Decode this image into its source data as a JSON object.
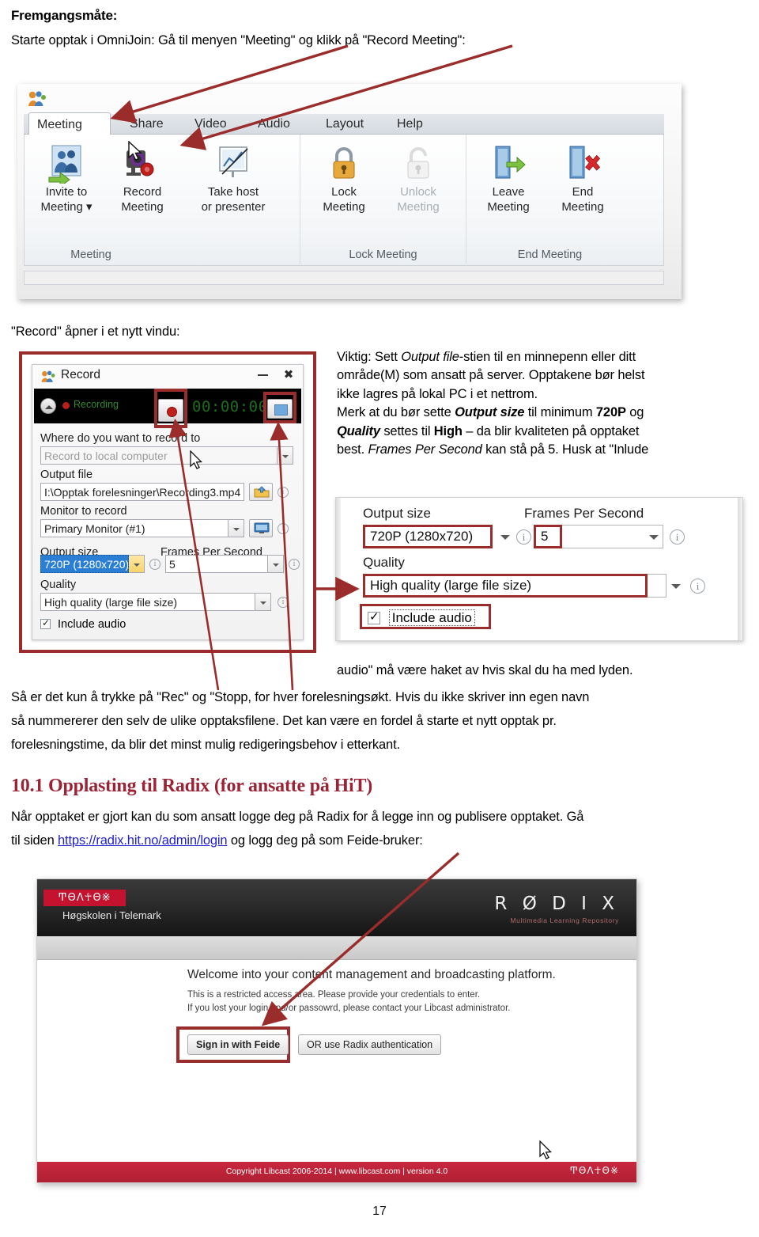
{
  "document": {
    "heading": "Fremgangsmåte:",
    "intro": "Starte opptak i OmniJoin: Gå til menyen \"Meeting\" og klikk på \"Record Meeting\":",
    "record_caption": "\"Record\" åpner i et nytt vindu:",
    "note_line1_pre": "Viktig: Sett ",
    "note_line1_em": "Output file",
    "note_line1_post": "-stien til en minnepenn eller ditt",
    "note_line2": "område(M) som ansatt på server. Opptakene bør helst",
    "note_line3": "ikke lagres på lokal PC i et nettrom.",
    "note_line4_pre": "Merk at du bør sette ",
    "note_line4_em": "Output size",
    "note_line4_mid": " til minimum ",
    "note_line4_b": "720P",
    "note_line4_post": " og",
    "note_line5_em": "Quality",
    "note_line5_mid": " settes til ",
    "note_line5_b": "High",
    "note_line5_post": " – da blir kvaliteten på opptaket",
    "note_line6_pre": "best. ",
    "note_line6_em": "Frames Per Second",
    "note_line6_post": " kan stå på 5. Husk at \"Inlude",
    "para_cont": "audio\" må være haket av hvis skal du ha med lyden.",
    "para2_line1": "Så er det kun å trykke på \"Rec\" og \"Stopp, for hver forelesningsøkt. Hvis du ikke skriver inn egen navn",
    "para2_line2": "så nummererer den selv de ulike opptaksfilene.  Det kan være en fordel å starte et nytt opptak pr.",
    "para2_line3": "forelesningstime, da blir det minst mulig redigeringsbehov i etterkant.",
    "section_heading": "10.1 Opplasting til Radix (for ansatte på HiT)",
    "para3_line1": "Når opptaket er gjort kan du som ansatt logge deg på Radix for å legge inn og publisere opptaket. Gå",
    "para3_line2_pre": "til siden ",
    "para3_link": "https://radix.hit.no/admin/login",
    "para3_line2_post": " og logg deg på som Feide-bruker:",
    "page_number": "17"
  },
  "omnijoin": {
    "tabs": [
      {
        "label": "Meeting",
        "active": true
      },
      {
        "label": "Share",
        "active": false
      },
      {
        "label": "Video",
        "active": false
      },
      {
        "label": "Audio",
        "active": false
      },
      {
        "label": "Layout",
        "active": false
      },
      {
        "label": "Help",
        "active": false
      }
    ],
    "groups": [
      {
        "name": "Meeting"
      },
      {
        "name": "Lock Meeting"
      },
      {
        "name": "End Meeting"
      }
    ],
    "buttons": [
      {
        "line1": "Invite to",
        "line2": "Meeting ▾",
        "icon": "invite-people-icon",
        "disabled": false
      },
      {
        "line1": "Record",
        "line2": "Meeting",
        "icon": "record-camera-icon",
        "disabled": false
      },
      {
        "line1": "Take host",
        "line2": "or presenter",
        "icon": "presenter-board-icon",
        "disabled": false
      },
      {
        "line1": "Lock",
        "line2": "Meeting",
        "icon": "padlock-closed-icon",
        "disabled": false
      },
      {
        "line1": "Unlock",
        "line2": "Meeting",
        "icon": "padlock-open-icon",
        "disabled": true
      },
      {
        "line1": "Leave",
        "line2": "Meeting",
        "icon": "door-exit-arrow-icon",
        "disabled": false
      },
      {
        "line1": "End",
        "line2": "Meeting",
        "icon": "door-exit-cross-icon",
        "disabled": false
      }
    ]
  },
  "record_dialog": {
    "title": "Record",
    "status_label": "Recording",
    "timer": "00:00:00",
    "fields": {
      "where_label": "Where do you want to record to",
      "where_value": "Record to local computer",
      "output_file_label": "Output file",
      "output_file_value": "I:\\Opptak forelesninger\\Recording3.mp4",
      "monitor_label": "Monitor to record",
      "monitor_value": "Primary Monitor (#1)",
      "output_size_label": "Output size",
      "output_size_value": "720P (1280x720)",
      "fps_label": "Frames Per Second",
      "fps_value": "5",
      "quality_label": "Quality",
      "quality_value": "High quality (large file size)",
      "include_audio_label": "Include audio"
    }
  },
  "zoom_panel": {
    "output_size_label": "Output size",
    "output_size_value": "720P (1280x720)",
    "fps_label": "Frames Per Second",
    "fps_value": "5",
    "quality_label": "Quality",
    "quality_value": "High quality (large file size)",
    "include_audio_label": "Include audio"
  },
  "radix": {
    "institution": "Høgskolen i Telemark",
    "brand": "R Ø D I X",
    "brand_runes": "ͲΘΛ☥Θ※",
    "tagline": "Multimedia Learning Repository",
    "welcome": "Welcome into your content management and broadcasting platform.",
    "sub1": "This is a restricted access area. Please provide your credentials to enter.",
    "sub2": "If you lost your login and/or passowrd, please contact your Libcast administrator.",
    "btn_feide": "Sign in with Feide",
    "btn_radix": "OR use Radix authentication",
    "footer": "Copyright Libcast 2006-2014   |   www.libcast.com   |   version 4.0"
  },
  "colors": {
    "accent_red": "#9b2c2c",
    "heading_red": "#9b2335",
    "link_blue": "#2222cc",
    "radix_red": "#c4122f"
  }
}
